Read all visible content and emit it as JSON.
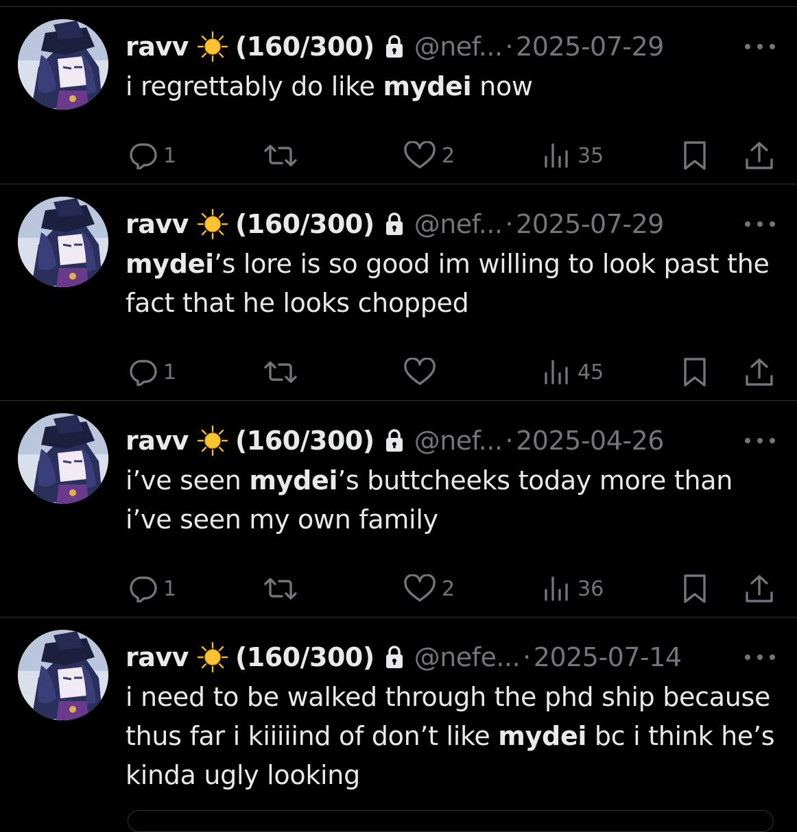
{
  "tweets": [
    {
      "name": "ravv",
      "counter": "(160/300)",
      "handle": "@nef...",
      "separator": "·",
      "date": "2025-07-29",
      "body": [
        {
          "t": "i regrettably do like "
        },
        {
          "t": "mydei",
          "b": true
        },
        {
          "t": " now"
        }
      ],
      "replies": "1",
      "reposts": "",
      "likes": "2",
      "views": "35"
    },
    {
      "name": "ravv",
      "counter": "(160/300)",
      "handle": "@nef...",
      "separator": "·",
      "date": "2025-07-29",
      "body": [
        {
          "t": "mydei",
          "b": true
        },
        {
          "t": "’s lore is so good im willing to look past the fact that he looks chopped"
        }
      ],
      "replies": "1",
      "reposts": "",
      "likes": "",
      "views": "45"
    },
    {
      "name": "ravv",
      "counter": "(160/300)",
      "handle": "@nef...",
      "separator": "·",
      "date": "2025-04-26",
      "body": [
        {
          "t": "i’ve seen "
        },
        {
          "t": "mydei",
          "b": true
        },
        {
          "t": "’s buttcheeks today more than i’ve seen my own family"
        }
      ],
      "replies": "1",
      "reposts": "",
      "likes": "2",
      "views": "36"
    },
    {
      "name": "ravv",
      "counter": "(160/300)",
      "handle": "@nefe...",
      "separator": "·",
      "date": "2025-07-14",
      "body": [
        {
          "t": "i need to be walked through the phd ship because thus far i kiiiiind of don’t like "
        },
        {
          "t": "mydei",
          "b": true
        },
        {
          "t": " bc i think he’s kinda ugly looking"
        }
      ],
      "replies": "",
      "reposts": "",
      "likes": "",
      "views": ""
    }
  ],
  "icons": {
    "avatar": "avatar-image",
    "verified_emoji": "sun-emoji-icon",
    "protected": "lock-icon",
    "more": "more-dots-icon",
    "reply": "reply-icon",
    "repost": "repost-icon",
    "like": "heart-icon",
    "views": "views-icon",
    "bookmark": "bookmark-icon",
    "share": "share-icon"
  },
  "colors": {
    "background": "#000000",
    "text": "#e7e9ea",
    "muted": "#71767b",
    "divider": "#2f3336"
  }
}
